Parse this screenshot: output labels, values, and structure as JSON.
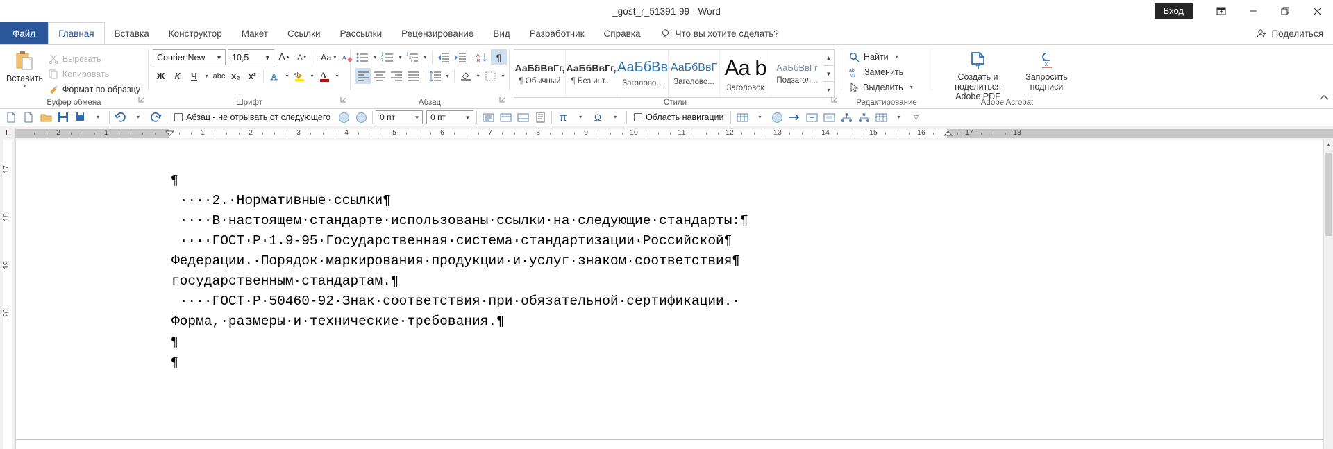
{
  "window": {
    "title": "_gost_r_51391-99  -  Word",
    "signin_label": "Вход",
    "ribbon_display_icon": "ribbon-display-options-icon",
    "minimize_icon": "minimize-icon",
    "restore_icon": "restore-icon",
    "close_icon": "close-icon"
  },
  "tabs": {
    "file": "Файл",
    "items": [
      "Главная",
      "Вставка",
      "Конструктор",
      "Макет",
      "Ссылки",
      "Рассылки",
      "Рецензирование",
      "Вид",
      "Разработчик",
      "Справка"
    ],
    "active": "Главная",
    "tellme_placeholder": "Что вы хотите сделать?",
    "share_label": "Поделиться"
  },
  "ribbon": {
    "clipboard": {
      "group_label": "Буфер обмена",
      "paste_label": "Вставить",
      "cut_label": "Вырезать",
      "copy_label": "Копировать",
      "format_painter_label": "Формат по образцу"
    },
    "font": {
      "group_label": "Шрифт",
      "font_name": "Courier New",
      "font_size": "10,5",
      "grow_label": "A",
      "shrink_label": "A",
      "case_label": "Aa",
      "clear_format_label": "A",
      "bold_label": "Ж",
      "italic_label": "К",
      "underline_label": "Ч",
      "strike_label": "abc",
      "subscript_label": "x₂",
      "superscript_label": "x²",
      "texteffects_label": "A",
      "highlight_label": "ab",
      "fontcolor_label": "A"
    },
    "paragraph": {
      "group_label": "Абзац",
      "bullets_icon": "bullet-list-icon",
      "numbering_icon": "numbered-list-icon",
      "multilevel_icon": "multilevel-list-icon",
      "decrease_indent_icon": "decrease-indent-icon",
      "increase_indent_icon": "increase-indent-icon",
      "sort_icon": "sort-az-icon",
      "show_marks_icon": "show-formatting-marks-icon",
      "align_left_icon": "align-left-icon",
      "align_center_icon": "align-center-icon",
      "align_right_icon": "align-right-icon",
      "justify_icon": "justify-icon",
      "line_spacing_icon": "line-spacing-icon",
      "shading_icon": "shading-icon",
      "borders_icon": "borders-icon"
    },
    "styles": {
      "group_label": "Стили",
      "items": [
        {
          "preview": "АаБбВвГг,",
          "name": "¶ Обычный"
        },
        {
          "preview": "АаБбВвГг,",
          "name": "¶ Без инт..."
        },
        {
          "preview": "АаБбВв",
          "name": "Заголово..."
        },
        {
          "preview": "АаБбВвГ",
          "name": "Заголово..."
        },
        {
          "preview": "Аа b",
          "name": "Заголовок"
        },
        {
          "preview": "АаБбВвГг",
          "name": "Подзагол..."
        }
      ]
    },
    "editing": {
      "group_label": "Редактирование",
      "find_label": "Найти",
      "replace_label": "Заменить",
      "select_label": "Выделить"
    },
    "acrobat": {
      "group_label": "Adobe Acrobat",
      "create_share_label": "Создать и поделиться\nAdobe PDF",
      "request_sign_label": "Запросить\nподписи"
    }
  },
  "addin_toolbar": {
    "keep_with_next_label": "Абзац - не отрывать от следующего",
    "spacing_before": "0 пт",
    "spacing_after": "0 пт",
    "nav_pane_label": "Область навигации",
    "pi_label": "π",
    "omega_label": "Ω"
  },
  "ruler": {
    "corner_label": "L",
    "h_numbers": [
      "2",
      "1",
      "1",
      "2",
      "3",
      "4",
      "5",
      "6",
      "7",
      "8",
      "9",
      "10",
      "11",
      "12",
      "13",
      "14",
      "15",
      "16",
      "17",
      "18"
    ],
    "v_numbers": [
      "17",
      "18",
      "19",
      "20"
    ]
  },
  "document": {
    "lines": [
      "¶",
      " ····2.·Нормативные·ссылки¶",
      " ····В·настоящем·стандарте·использованы·ссылки·на·следующие·стандарты:¶",
      " ····ГОСТ·Р·1.9-95·Государственная·система·стандартизации·Российской¶",
      "Федерации.·Порядок·маркирования·продукции·и·услуг·знаком·соответствия¶",
      "государственным·стандартам.¶",
      " ····ГОСТ·Р·50460-92·Знак·соответствия·при·обязательной·сертификации.·",
      "Форма,·размеры·и·технические·требования.¶",
      "¶",
      "¶"
    ]
  },
  "colors": {
    "word_blue": "#2b579a",
    "accent_light": "#cfdff2",
    "ribbon_border": "#d4d4d4"
  }
}
